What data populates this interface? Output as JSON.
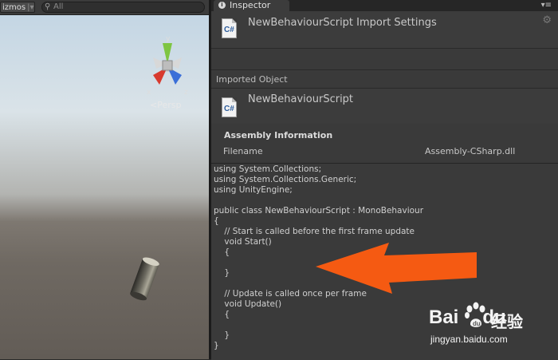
{
  "scene": {
    "gizmos_label": "izmos",
    "search_placeholder": "All",
    "persp_label": "Persp",
    "axis_labels": {
      "x": "x",
      "y": "y",
      "z": "z"
    }
  },
  "inspector": {
    "tab_label": "Inspector",
    "header": {
      "title": "NewBehaviourScript Import Settings",
      "icon_text": "C#"
    },
    "imported_object_label": "Imported Object",
    "object": {
      "name": "NewBehaviourScript",
      "icon_text": "C#"
    },
    "assembly": {
      "title": "Assembly Information",
      "filename_label": "Filename",
      "filename_value": "Assembly-CSharp.dll"
    },
    "code": "using System.Collections;\nusing System.Collections.Generic;\nusing UnityEngine;\n\npublic class NewBehaviourScript : MonoBehaviour\n{\n    // Start is called before the first frame update\n    void Start()\n    {\n        \n    }\n\n    // Update is called once per frame\n    void Update()\n    {\n        \n    }\n}"
  },
  "watermark": {
    "brand": "Bai",
    "brand_tail": "du",
    "chinese": "经验",
    "url": "jingyan.baidu.com"
  },
  "colors": {
    "arrow": "#f55a12",
    "gizmo_x": "#d83a2e",
    "gizmo_y": "#7ec542",
    "gizmo_z": "#3a6fd8"
  }
}
